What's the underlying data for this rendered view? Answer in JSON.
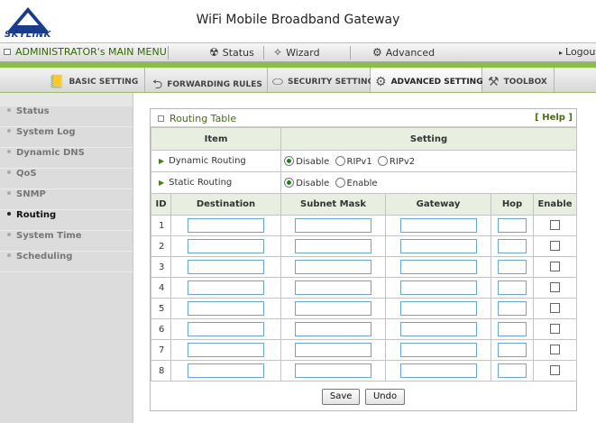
{
  "header": {
    "logo_text": "SKYLINK",
    "title": "WiFi Mobile Broadband Gateway"
  },
  "menubar": {
    "admin_label": "ADMINISTRATOR's MAIN MENU",
    "status_label": "Status",
    "wizard_label": "Wizard",
    "advanced_label": "Advanced",
    "logout_label": "Logout"
  },
  "tabs": [
    {
      "label": "BASIC SETTING",
      "icon": "folder-icon"
    },
    {
      "label": "FORWARDING RULES",
      "icon": "forward-icon"
    },
    {
      "label": "SECURITY SETTING",
      "icon": "lock-icon"
    },
    {
      "label": "ADVANCED SETTING",
      "icon": "advanced-icon"
    },
    {
      "label": "TOOLBOX",
      "icon": "toolbox-icon"
    }
  ],
  "sidebar": {
    "items": [
      {
        "label": "Status"
      },
      {
        "label": "System Log"
      },
      {
        "label": "Dynamic DNS"
      },
      {
        "label": "QoS"
      },
      {
        "label": "SNMP"
      },
      {
        "label": "Routing"
      },
      {
        "label": "System Time"
      },
      {
        "label": "Scheduling"
      }
    ]
  },
  "panel": {
    "title": "Routing Table",
    "help": "[ Help ]",
    "item_header": "Item",
    "setting_header": "Setting",
    "dynamic_label": "Dynamic Routing",
    "dynamic_options": [
      "Disable",
      "RIPv1",
      "RIPv2"
    ],
    "dynamic_selected": "Disable",
    "static_label": "Static Routing",
    "static_options": [
      "Disable",
      "Enable"
    ],
    "static_selected": "Disable",
    "columns": [
      "ID",
      "Destination",
      "Subnet Mask",
      "Gateway",
      "Hop",
      "Enable"
    ],
    "rows": [
      "1",
      "2",
      "3",
      "4",
      "5",
      "6",
      "7",
      "8"
    ],
    "save_label": "Save",
    "undo_label": "Undo"
  },
  "colors": {
    "accent_green": "#8bbf3f",
    "title_green": "#4a6c1a",
    "input_border": "#6aa6c9"
  }
}
